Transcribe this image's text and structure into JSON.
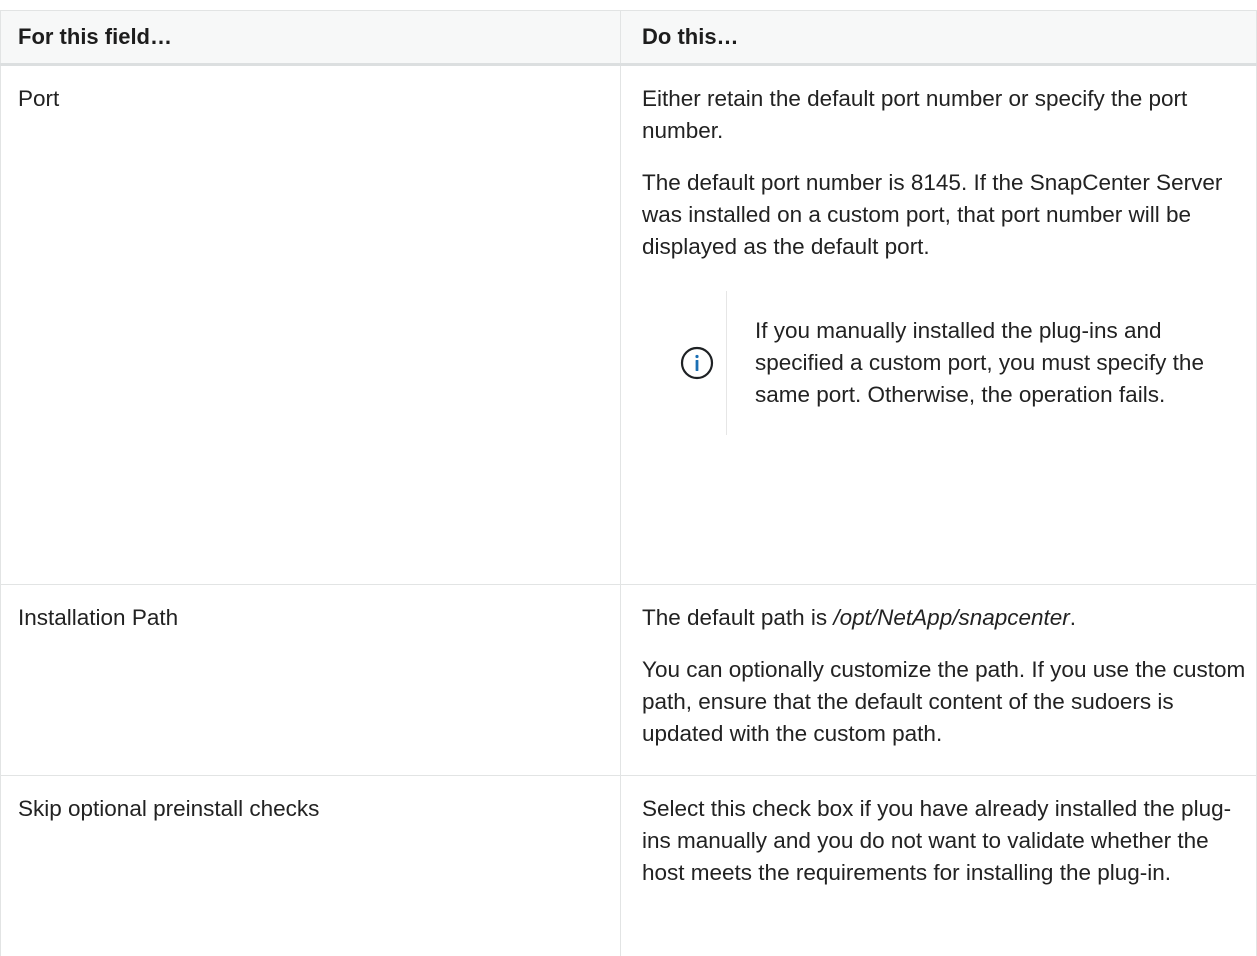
{
  "table": {
    "headers": [
      "For this field…",
      "Do this…"
    ],
    "rows": [
      {
        "field": "Port",
        "paragraphs": [
          "Either retain the default port number or specify the port number.",
          "The default port number is 8145. If the SnapCenter Server was installed on a custom port, that port number will be displayed as the default port."
        ],
        "note": "If you manually installed the plug-ins and specified a custom port, you must specify the same port. Otherwise, the operation fails.",
        "note_icon": "info-circle-icon"
      },
      {
        "field": "Installation Path",
        "path_prefix": "The default path is ",
        "path_value": "/opt/NetApp/snapcenter",
        "path_suffix": ".",
        "paragraph2": "You can optionally customize the path. If you use the custom path, ensure that the default content of the sudoers is updated with the custom path."
      },
      {
        "field": "Skip optional preinstall checks",
        "paragraph": "Select this check box if you have already installed the plug-ins manually and you do not want to validate whether the host meets the requirements for installing the plug-in."
      }
    ]
  },
  "colors": {
    "header_bg": "#f7f8f8",
    "border": "#e2e4e4",
    "icon": "#1a6fb4",
    "text": "#222222"
  }
}
